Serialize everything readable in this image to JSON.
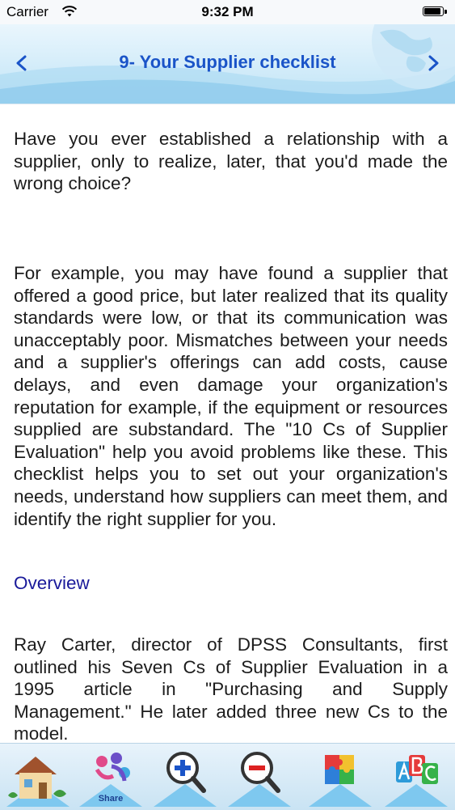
{
  "status_bar": {
    "carrier": "Carrier",
    "time": "9:32 PM"
  },
  "header": {
    "title": "9- Your Supplier checklist",
    "back_icon": "chevron-left-icon",
    "forward_icon": "chevron-right-icon",
    "title_color": "#1a54c8"
  },
  "content": {
    "paragraph1": "Have you ever established a relationship with a supplier, only to realize, later, that you'd made the wrong choice?",
    "paragraph2": "For example, you may have found a supplier that offered a good price, but later realized that its quality standards were low, or that its communication was unacceptably poor. Mismatches between your needs and a supplier's offerings can add costs, cause delays, and even damage your organization's reputation for example, if the equipment or resources supplied are substandard. The \"10 Cs of Supplier Evaluation\" help you avoid problems like these. This checklist helps you to set out your organization's needs, understand how suppliers can meet them, and identify the right supplier for you.",
    "overview_link": "Overview",
    "paragraph3": "Ray Carter, director of DPSS Consultants, first outlined his Seven Cs of Supplier Evaluation in a 1995 article in \"Purchasing and Supply Management.\" He later added three new Cs to the model."
  },
  "toolbar": {
    "share_label": "Share",
    "items": [
      {
        "icon": "home-icon"
      },
      {
        "icon": "share-icon"
      },
      {
        "icon": "zoom-in-icon"
      },
      {
        "icon": "zoom-out-icon"
      },
      {
        "icon": "puzzle-icon"
      },
      {
        "icon": "abc-icon"
      }
    ]
  }
}
